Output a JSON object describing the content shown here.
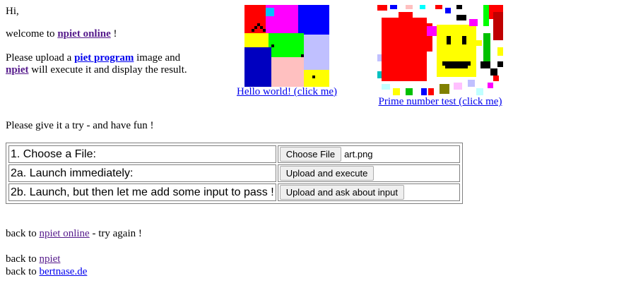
{
  "intro": {
    "greeting": "Hi,",
    "welcome_prefix": "welcome to ",
    "welcome_link": "npiet online",
    "welcome_suffix": " !",
    "upload_prefix": "Please upload a ",
    "upload_link": "piet program",
    "upload_middle": " image and",
    "npiet_link": "npiet",
    "upload_suffix": " will execute it and display the result."
  },
  "examples": [
    {
      "caption": "Hello world! (click me)"
    },
    {
      "caption": "Prime number test (click me)"
    }
  ],
  "try_text": "Please give it a try - and have fun !",
  "form": {
    "row1_label": "1. Choose a File:",
    "choose_button": "Choose File",
    "chosen_file": "art.png",
    "row2_label": "2a. Launch immediately:",
    "upload_execute_button": "Upload and execute",
    "row3_label": "2b. Launch, but then let me add some input to pass !",
    "upload_ask_button": "Upload and ask about input"
  },
  "footer": {
    "back_prefix": "back to ",
    "link1": "npiet online",
    "link1_suffix": " - try again !",
    "link2": "npiet",
    "link3": "bertnase.de"
  }
}
